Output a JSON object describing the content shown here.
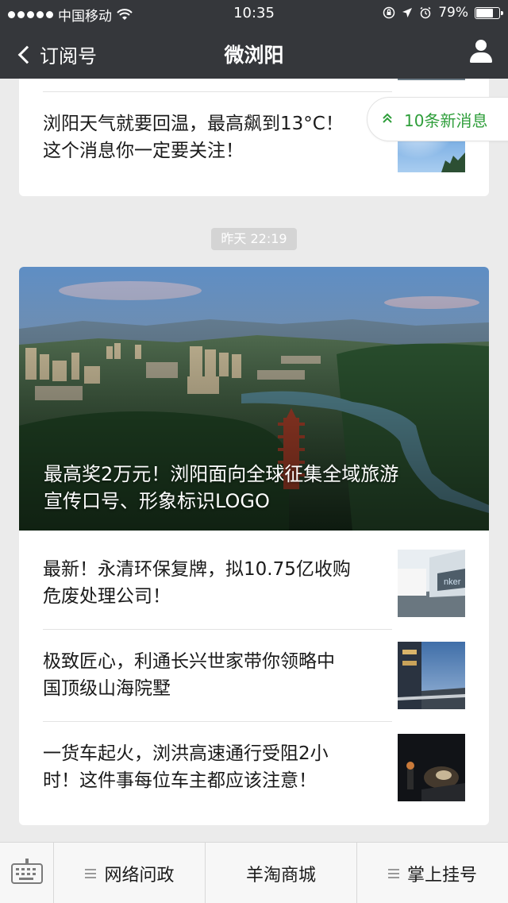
{
  "status_bar": {
    "carrier": "中国移动",
    "time": "10:35",
    "battery": "79%",
    "battery_level": 0.79
  },
  "nav": {
    "back_label": "订阅号",
    "title": "微浏阳",
    "profile_icon": "person-icon"
  },
  "new_messages": {
    "label": "10条新消息",
    "icon": "double-chevron-up-icon"
  },
  "previous_card": {
    "articles": [
      {
        "title_line1": "浏阳天气就要回温，最高飙到13°C！",
        "title_line2": "这个消息你一定要关注！"
      }
    ]
  },
  "time_divider": "昨天 22:19",
  "digest": {
    "headline": {
      "title_line1": "最高奖2万元！浏阳面向全球征集全域旅游",
      "title_line2": "宣传口号、形象标识LOGO"
    },
    "articles": [
      {
        "title_line1": "最新！永清环保复牌，拟10.75亿收购",
        "title_line2": "危废处理公司！"
      },
      {
        "title_line1": "极致匠心，利通长兴世家带你领略中",
        "title_line2": "国顶级山海院墅"
      },
      {
        "title_line1": "一货车起火，浏洪高速通行受阻2小",
        "title_line2": "时！这件事每位车主都应该注意！"
      }
    ]
  },
  "bottom_menu": {
    "keyboard_icon": "keyboard-icon",
    "items": [
      {
        "label": "网络问政",
        "has_submenu": true
      },
      {
        "label": "羊淘商城",
        "has_submenu": false
      },
      {
        "label": "掌上挂号",
        "has_submenu": true
      }
    ]
  }
}
